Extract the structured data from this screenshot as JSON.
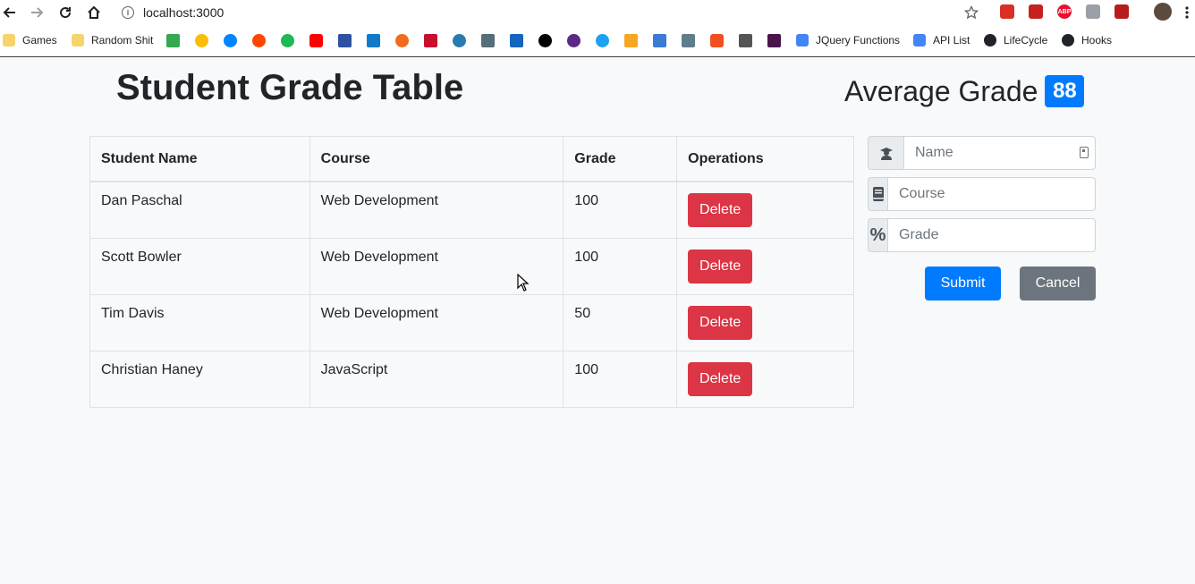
{
  "browser": {
    "url": "localhost:3000",
    "bookmarks": [
      {
        "label": "Games",
        "icon": "folder-icon"
      },
      {
        "label": "Random Shit",
        "icon": "folder-icon"
      },
      {
        "label": "JQuery Functions",
        "icon": "doc-icon"
      },
      {
        "label": "API List",
        "icon": "doc-icon"
      },
      {
        "label": "LifeCycle",
        "icon": "react-icon"
      },
      {
        "label": "Hooks",
        "icon": "react-icon"
      }
    ],
    "extension_abp": "ABP"
  },
  "page": {
    "title": "Student Grade Table",
    "average_label": "Average Grade",
    "average_value": "88"
  },
  "table": {
    "headers": [
      "Student Name",
      "Course",
      "Grade",
      "Operations"
    ],
    "rows": [
      {
        "name": "Dan Paschal",
        "course": "Web Development",
        "grade": "100",
        "action": "Delete"
      },
      {
        "name": "Scott Bowler",
        "course": "Web Development",
        "grade": "100",
        "action": "Delete"
      },
      {
        "name": "Tim Davis",
        "course": "Web Development",
        "grade": "50",
        "action": "Delete"
      },
      {
        "name": "Christian Haney",
        "course": "JavaScript",
        "grade": "100",
        "action": "Delete"
      }
    ]
  },
  "form": {
    "name_placeholder": "Name",
    "course_placeholder": "Course",
    "grade_placeholder": "Grade",
    "grade_icon": "%",
    "submit_label": "Submit",
    "cancel_label": "Cancel"
  },
  "colors": {
    "primary": "#007bff",
    "danger": "#dc3545",
    "secondary": "#6c757d"
  }
}
